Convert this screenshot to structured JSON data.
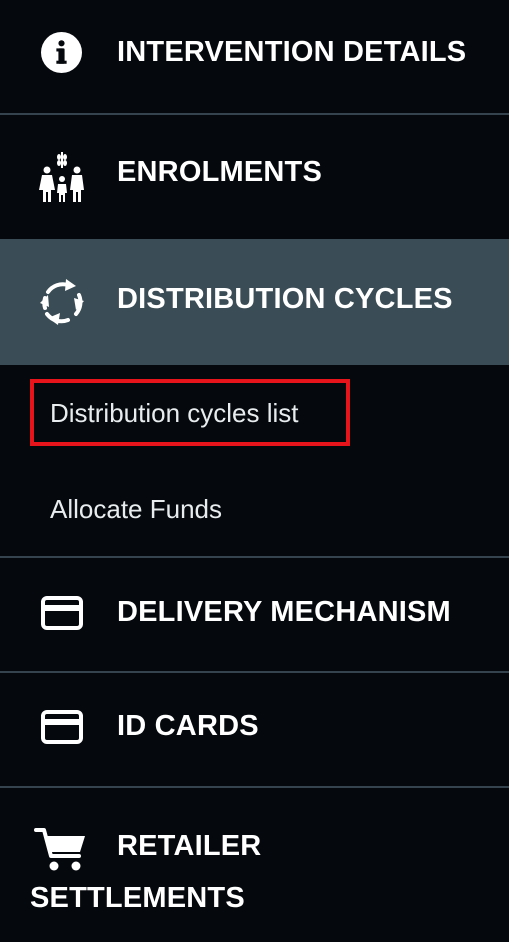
{
  "sidebar": {
    "items": [
      {
        "label": "INTERVENTION DETAILS",
        "icon": "info-icon"
      },
      {
        "label": "ENROLMENTS",
        "icon": "family-icon"
      },
      {
        "label": "DISTRIBUTION CYCLES",
        "icon": "refresh-cycle-icon",
        "active": true
      },
      {
        "label": "DELIVERY MECHANISM",
        "icon": "card-icon"
      },
      {
        "label": "ID CARDS",
        "icon": "card-icon"
      },
      {
        "label": "RETAILER SETTLEMENTS",
        "icon": "cart-icon",
        "label_line1": "RETAILER",
        "label_line2": "SETTLEMENTS"
      }
    ],
    "subitems": [
      {
        "label": "Distribution cycles list",
        "highlighted": true
      },
      {
        "label": "Allocate Funds"
      }
    ]
  },
  "colors": {
    "background": "#05080c",
    "active_background": "#3a4c55",
    "divider": "#34434d",
    "highlight_border": "#e8141c",
    "text": "#ffffff"
  }
}
